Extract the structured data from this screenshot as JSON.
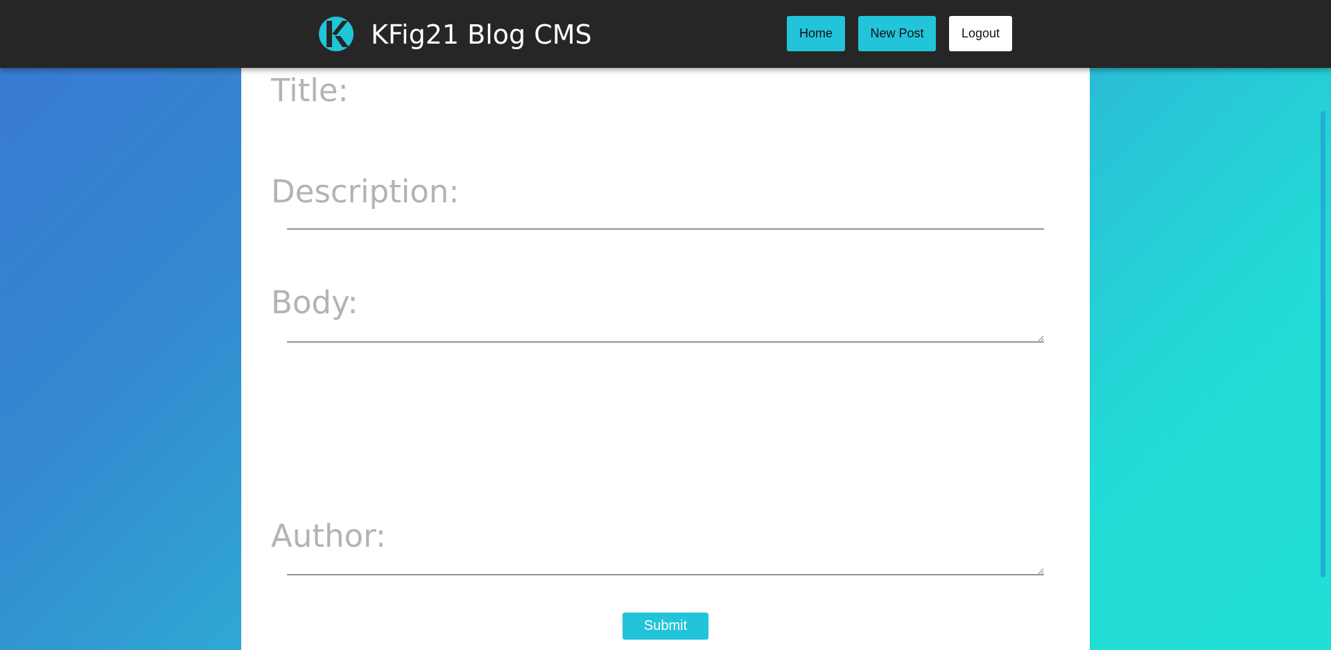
{
  "header": {
    "logo_icon": "kfig21-logo-icon",
    "brand_title": "KFig21 Blog CMS",
    "nav": {
      "home_label": "Home",
      "new_post_label": "New Post",
      "logout_label": "Logout"
    }
  },
  "form": {
    "title_label": "Title:",
    "title_value": "",
    "description_label": "Description:",
    "description_value": "",
    "body_label": "Body:",
    "body_value": "",
    "author_label": "Author:",
    "author_value": "",
    "submit_label": "Submit"
  },
  "colors": {
    "header_bg": "#262626",
    "accent": "#22c4d9",
    "label_gray": "#b3b3b3",
    "bg_gradient_start": "#3a78d2",
    "bg_gradient_end": "#21dfd6"
  }
}
